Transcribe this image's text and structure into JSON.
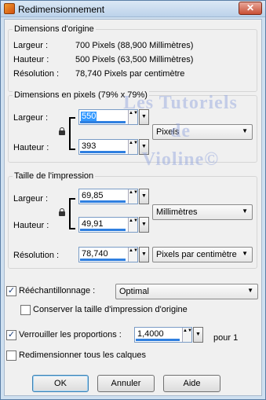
{
  "window": {
    "title": "Redimensionnement",
    "close_symbol": "✕"
  },
  "original": {
    "title": "Dimensions d'origine",
    "width_label": "Largeur :",
    "width_value": "700 Pixels (88,900 Millimètres)",
    "height_label": "Hauteur :",
    "height_value": "500 Pixels (63,500 Millimètres)",
    "resolution_label": "Résolution :",
    "resolution_value": "78,740 Pixels par centimètre"
  },
  "pixels": {
    "title": "Dimensions en pixels (79% x 79%)",
    "width_label": "Largeur :",
    "width_value": "550",
    "height_label": "Hauteur :",
    "height_value": "393",
    "unit": "Pixels"
  },
  "print": {
    "title": "Taille de l'impression",
    "width_label": "Largeur :",
    "width_value": "69,85",
    "height_label": "Hauteur :",
    "height_value": "49,91",
    "unit": "Millimètres",
    "resolution_label": "Résolution :",
    "resolution_value": "78,740",
    "resolution_unit": "Pixels par centimètre"
  },
  "options": {
    "resample_label": "Rééchantillonnage :",
    "resample_checked": true,
    "resample_method": "Optimal",
    "keep_print_size_label": "Conserver la taille d'impression d'origine",
    "keep_print_size_checked": false,
    "lock_ratio_label": "Verrouiller les proportions :",
    "lock_ratio_checked": true,
    "ratio_value": "1,4000",
    "ratio_suffix": "pour 1",
    "resize_all_layers_label": "Redimensionner tous les calques",
    "resize_all_layers_checked": false
  },
  "buttons": {
    "ok": "OK",
    "cancel": "Annuler",
    "help": "Aide"
  },
  "watermark": {
    "line1": "Les Tutoriels",
    "line2": "de",
    "line3": "Violine©"
  },
  "symbols": {
    "check": "✓",
    "spin": "▲▼",
    "drop": "▼"
  }
}
